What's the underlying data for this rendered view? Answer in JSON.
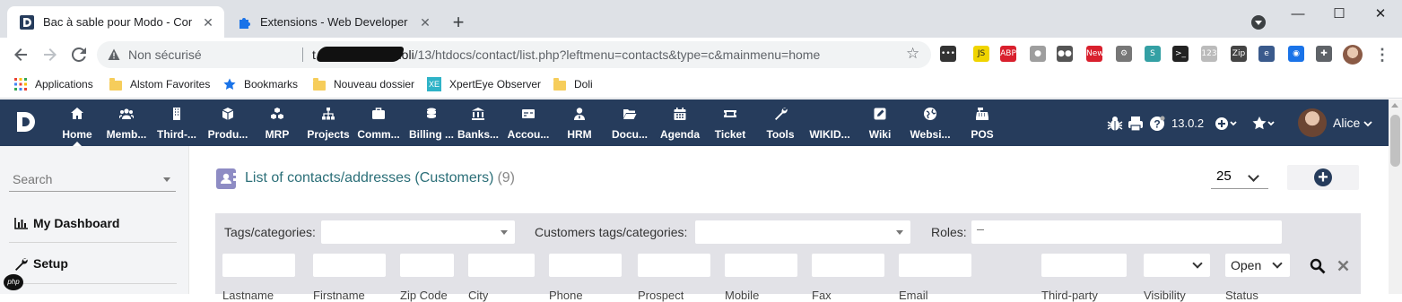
{
  "browser": {
    "tabs": [
      {
        "title": "Bac à sable pour Modo - Contacts",
        "active": true,
        "favicon": "dolibarr-icon"
      },
      {
        "title": "Extensions - Web Developer",
        "active": false,
        "favicon": "puzzle-icon"
      }
    ],
    "window_buttons": {
      "minimize": "—",
      "maximize": "☐",
      "close": "✕"
    },
    "omnibox": {
      "security_label": "Non sécurisé",
      "url_host_prefix": "t",
      "url_host": "doli",
      "url_path": "/13/htdocs/contact/list.php?leftmenu=contacts&type=c&mainmenu=home"
    },
    "extensions": [
      {
        "name": "web-developer-icon",
        "text": "•••",
        "color": "#333333"
      },
      {
        "name": "js-icon",
        "text": "JS",
        "color": "#f0d400"
      },
      {
        "name": "adblock-icon",
        "text": "ABP",
        "color": "#d9202d"
      },
      {
        "name": "spy-icon",
        "text": "●",
        "color": "#9e9e9e"
      },
      {
        "name": "dots-icon",
        "text": "●●",
        "color": "#555555"
      },
      {
        "name": "new-badge-icon",
        "text": "New",
        "color": "#d9202d"
      },
      {
        "name": "gear-ext-icon",
        "text": "⚙",
        "color": "#777777"
      },
      {
        "name": "s-ext-icon",
        "text": "S",
        "color": "#34a0a4"
      },
      {
        "name": "terminal-icon",
        "text": ">_",
        "color": "#222222"
      },
      {
        "name": "numbers-icon",
        "text": "123",
        "color": "#bbbbbb"
      },
      {
        "name": "gitzip-icon",
        "text": "Zip",
        "color": "#444444"
      },
      {
        "name": "e-ext-icon",
        "text": "e",
        "color": "#3a5a8c"
      },
      {
        "name": "screenshot-icon",
        "text": "◉",
        "color": "#1a73e8"
      },
      {
        "name": "extensions-puzzle-icon",
        "text": "✚",
        "color": "#5f6368"
      }
    ],
    "bookmarks": [
      {
        "label": "Applications",
        "icon": "apps-grid-icon"
      },
      {
        "label": "Alstom Favorites",
        "icon": "folder-icon"
      },
      {
        "label": "Bookmarks",
        "icon": "star-icon"
      },
      {
        "label": "Nouveau dossier",
        "icon": "folder-icon"
      },
      {
        "label": "XpertEye Observer",
        "icon": "xe-icon"
      },
      {
        "label": "Doli",
        "icon": "folder-icon"
      }
    ]
  },
  "topmenu": {
    "items": [
      {
        "label": "Home",
        "icon": "home-icon",
        "selected": true
      },
      {
        "label": "Memb...",
        "icon": "members-icon"
      },
      {
        "label": "Third-...",
        "icon": "building-icon"
      },
      {
        "label": "Produ...",
        "icon": "cube-icon"
      },
      {
        "label": "MRP",
        "icon": "cubes-icon"
      },
      {
        "label": "Projects",
        "icon": "sitemap-icon"
      },
      {
        "label": "Comm...",
        "icon": "suitcase-icon"
      },
      {
        "label": "Billing ...",
        "icon": "coins-icon"
      },
      {
        "label": "Banks...",
        "icon": "bank-icon"
      },
      {
        "label": "Accou...",
        "icon": "money-check-icon"
      },
      {
        "label": "HRM",
        "icon": "user-tie-icon"
      },
      {
        "label": "Docu...",
        "icon": "folder-open-icon"
      },
      {
        "label": "Agenda",
        "icon": "calendar-icon"
      },
      {
        "label": "Ticket",
        "icon": "ticket-icon"
      },
      {
        "label": "Tools",
        "icon": "wrench-icon"
      },
      {
        "label": "WIKID...",
        "icon": "wiki-icon"
      },
      {
        "label": "Wiki",
        "icon": "edit-icon"
      },
      {
        "label": "Websi...",
        "icon": "globe-icon"
      },
      {
        "label": "POS",
        "icon": "cash-register-icon"
      }
    ],
    "version": "13.0.2",
    "user": "Alice"
  },
  "leftmenu": {
    "search_placeholder": "Search",
    "items": [
      {
        "label": "My Dashboard",
        "icon": "chart-bar-icon"
      },
      {
        "label": "Setup",
        "icon": "wrench-icon"
      }
    ]
  },
  "main": {
    "title": "List of contacts/addresses (Customers)",
    "count": "(9)",
    "page_limit": "25",
    "filters": {
      "tags_label": "Tags/categories:",
      "customer_tags_label": "Customers tags/categories:",
      "roles_label": "Roles:",
      "status_value": "Open"
    },
    "columns": [
      "Lastname",
      "Firstname",
      "Zip Code",
      "City",
      "Phone",
      "Prospect",
      "Mobile",
      "Fax",
      "Email",
      "Third-party",
      "Visibility",
      "Status"
    ]
  }
}
